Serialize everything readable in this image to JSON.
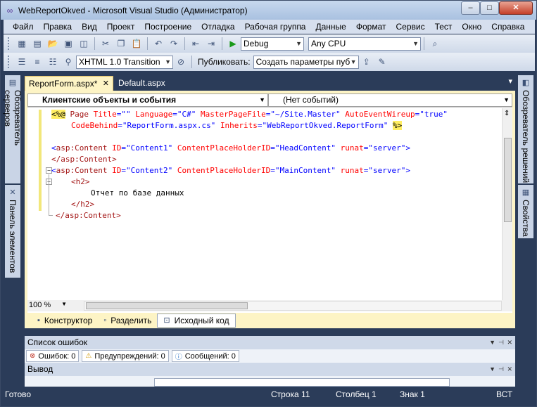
{
  "window": {
    "title": "WebReportOkved - Microsoft Visual Studio (Администратор)"
  },
  "window_controls": {
    "minimize": "–",
    "maximize": "□",
    "close": "✕"
  },
  "menu": [
    "Файл",
    "Правка",
    "Вид",
    "Проект",
    "Построение",
    "Отладка",
    "Рабочая группа",
    "Данные",
    "Формат",
    "Сервис",
    "Тест",
    "Окно",
    "Справка"
  ],
  "toolbar1": {
    "config": "Debug",
    "platform": "Any CPU"
  },
  "toolbar2": {
    "doctype": "XHTML 1.0 Transition",
    "publish_label": "Публиковать:",
    "publish_value": "Создать параметры пуб"
  },
  "left_strip": {
    "server_explorer": "Обозреватель серверов",
    "toolbox": "Панель элементов"
  },
  "right_strip": {
    "solution_explorer": "Обозреватель решений",
    "properties": "Свойства"
  },
  "doc_tabs": {
    "active": "ReportForm.aspx*",
    "other": "Default.aspx"
  },
  "editor": {
    "nav_left": "Клиентские объекты и события",
    "nav_right": "(Нет событий)",
    "code": {
      "l1a": "<%@",
      "l1b": " Page ",
      "l1c": "Title",
      "l1d": "=\"\" ",
      "l1e": "Language",
      "l1f": "=\"C#\" ",
      "l1g": "MasterPageFile",
      "l1h": "=\"~/Site.Master\" ",
      "l1i": "AutoEventWireup",
      "l1j": "=\"true\"",
      "l2a": "CodeBehind",
      "l2b": "=\"ReportForm.aspx.cs\" ",
      "l2c": "Inherits",
      "l2d": "=\"WebReportOkved.ReportForm\" ",
      "l2e": "%>",
      "l4a": "<",
      "l4b": "asp:Content",
      "l4c": "ID",
      "l4d": "=\"Content1\" ",
      "l4e": "ContentPlaceHolderID",
      "l4f": "=\"HeadContent\" ",
      "l4g": "runat",
      "l4h": "=\"server\">",
      "l5": "</asp:Content>",
      "l6a": "<",
      "l6b": "asp:Content",
      "l6c": "ID",
      "l6d": "=\"Content2\" ",
      "l6e": "ContentPlaceHolderID",
      "l6f": "=\"MainContent\" ",
      "l6g": "runat",
      "l6h": "=\"server\">",
      "l7": "<h2>",
      "l8": "Отчет по базе данных",
      "l9": "</h2>",
      "l10": "</asp:Content>"
    },
    "zoom": "100 %"
  },
  "view_tabs": {
    "design": "Конструктор",
    "split": "Разделить",
    "source": "Исходный код"
  },
  "error_list": {
    "title": "Список ошибок",
    "errors": "Ошибок: 0",
    "warnings": "Предупреждений: 0",
    "messages": "Сообщений: 0"
  },
  "output": {
    "title": "Вывод"
  },
  "status": {
    "ready": "Готово",
    "line": "Строка 11",
    "col": "Столбец 1",
    "char": "Знак 1",
    "mode": "ВСТ"
  }
}
